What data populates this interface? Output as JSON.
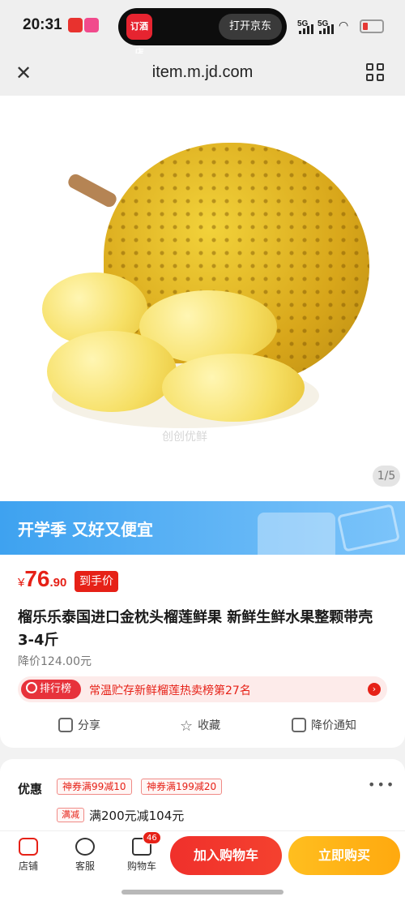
{
  "status_bar": {
    "time": "20:31",
    "pill_logo": "订酒店",
    "pill_button": "打开京东",
    "signal_1": "5G",
    "signal_2": "5G"
  },
  "browser": {
    "url": "item.m.jd.com"
  },
  "gallery": {
    "watermark": "创创优鲜",
    "counter": "1/5"
  },
  "banner": {
    "text": "开学季 又好又便宜"
  },
  "product": {
    "currency": "¥",
    "price_int": "76",
    "price_dec": ".90",
    "price_badge": "到手价",
    "title": "榴乐乐泰国进口金枕头榴莲鲜果 新鲜生鲜水果整颗带壳 3-4斤",
    "original_price": "降价124.00元",
    "rank_tag": "排行榜",
    "rank_text": "常温贮存新鲜榴莲热卖榜第27名"
  },
  "actions": {
    "share": "分享",
    "favorite": "收藏",
    "price_alert": "降价通知"
  },
  "promo": {
    "label": "优惠",
    "coupons": [
      "神券满99减10",
      "神券满199减20"
    ],
    "man_tag": "满减",
    "man_text": "满200元减104元"
  },
  "bottom_bar": {
    "store": "店铺",
    "service": "客服",
    "cart": "购物车",
    "cart_count": "46",
    "add_to_cart": "加入购物车",
    "buy_now": "立即购买"
  },
  "colors": {
    "accent_red": "#e62117",
    "buy_yellow": "#ffb11a",
    "banner_blue": "#3ea2f0"
  }
}
